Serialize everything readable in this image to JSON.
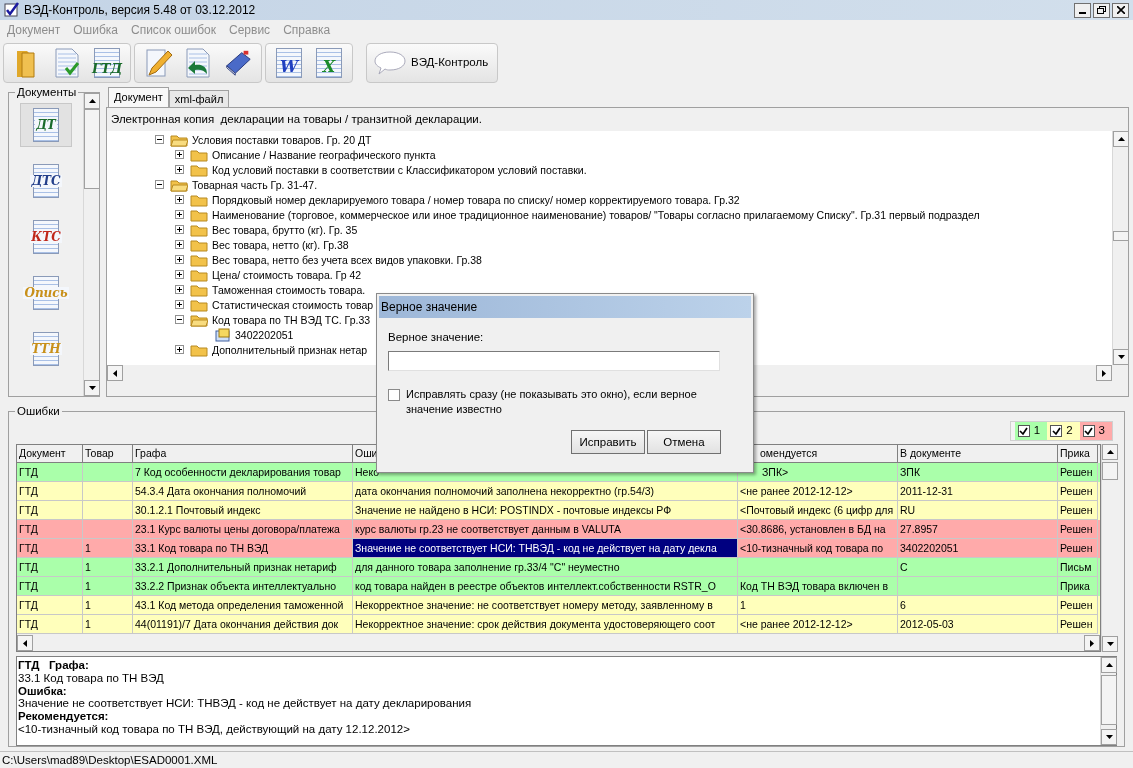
{
  "window": {
    "title": "ВЭД-Контроль, версия 5.48 от 03.12.2012"
  },
  "menu": [
    {
      "label": "Документ",
      "disabled": true
    },
    {
      "label": "Ошибка",
      "disabled": true
    },
    {
      "label": "Список ошибок",
      "disabled": true
    },
    {
      "label": "Сервис",
      "disabled": true
    },
    {
      "label": "Справка",
      "disabled": true
    }
  ],
  "toolbar": {
    "groups": [
      [
        {
          "kind": "folder"
        },
        {
          "kind": "check"
        },
        {
          "kind": "label",
          "label": "ГТД"
        }
      ],
      [
        {
          "kind": "pencil"
        },
        {
          "kind": "undo"
        },
        {
          "kind": "book"
        }
      ],
      [
        {
          "kind": "letter",
          "label": "W",
          "color": "#2040c0"
        },
        {
          "kind": "letter",
          "label": "X",
          "color": "#1a8a2a"
        }
      ]
    ],
    "app_button": {
      "label": "ВЭД-Контроль"
    }
  },
  "documents": {
    "title": "Документы",
    "items": [
      {
        "label": "ДТ",
        "color": "#1a6b2a",
        "selected": true
      },
      {
        "label": "ДТС",
        "color": "#233f8a",
        "selected": false
      },
      {
        "label": "КТС",
        "color": "#c0281c",
        "selected": false
      },
      {
        "label": "Опись",
        "color": "#c8901a",
        "selected": false
      },
      {
        "label": "ТТН",
        "color": "#c8901a",
        "selected": false
      }
    ]
  },
  "tabs": [
    {
      "label": "Документ",
      "selected": true
    },
    {
      "label": "xml-файл",
      "selected": false
    }
  ],
  "caption": "Электронная копия  декларации на товары / транзитной декларации.",
  "tree": [
    {
      "label": "Условия поставки товаров. Гр. 20 ДТ",
      "expanded": true,
      "children": [
        {
          "label": "Описание / Название географического пункта",
          "expanded": false
        },
        {
          "label": "Код условий поставки в соответствии с Классификатором условий поставки.",
          "expanded": false
        }
      ]
    },
    {
      "label": "Товарная часть Гр. 31-47.",
      "expanded": true,
      "children": [
        {
          "label": "Порядковый номер декларируемого  товара / номер товара по списку/ номер корректируемого товара.  Гр.32",
          "expanded": false
        },
        {
          "label": "Наименование (торговое, коммерческое или иное традиционное наименование) товаров/ \"Товары согласно прилагаемому Списку\". Гр.31 первый подраздел",
          "expanded": false
        },
        {
          "label": "Вес товара, брутто (кг). Гр. 35",
          "expanded": false
        },
        {
          "label": "Вес товара, нетто (кг). Гр.38",
          "expanded": false
        },
        {
          "label": "Вес товара, нетто без учета всех видов упаковки. Гр.38",
          "expanded": false
        },
        {
          "label": "Цена/ стоимость товара. Гр 42",
          "expanded": false
        },
        {
          "label": "Таможенная стоимость товара.",
          "expanded": false
        },
        {
          "label": "Статистическая стоимость товар",
          "expanded": false
        },
        {
          "label": "Код товара по ТН ВЭД ТС. Гр.33",
          "expanded": true,
          "children": [
            {
              "label": "3402202051",
              "kind": "value"
            }
          ]
        },
        {
          "label": "Дополнительный признак нетар",
          "expanded": false
        }
      ]
    }
  ],
  "errors": {
    "title": "Ошибки",
    "legend": [
      {
        "label": "1",
        "checked": true,
        "color": "#aaffaa"
      },
      {
        "label": "2",
        "checked": true,
        "color": "#ffffbb"
      },
      {
        "label": "3",
        "checked": true,
        "color": "#ffaaaa"
      }
    ],
    "columns": [
      "Документ",
      "Товар",
      "Графа",
      "Оши",
      "омендуется",
      "В документе",
      "Прика"
    ],
    "rows": [
      {
        "color": "#aaffaa",
        "selected": false,
        "cells": [
          "ГТД",
          "",
          "7 Код особенности декларирования товар",
          "Неко",
          "ЗПК>",
          "ЗПК",
          "Решен"
        ]
      },
      {
        "color": "#ffffbb",
        "selected": false,
        "cells": [
          "ГТД",
          "",
          "54.3.4 Дата окончания полномочий",
          "дата окончания полномочий заполнена некорректно (гр.54/3)",
          "<не ранее 2012-12-12>",
          "2011-12-31",
          "Решен"
        ]
      },
      {
        "color": "#ffffbb",
        "selected": false,
        "cells": [
          "ГТД",
          "",
          "30.1.2.1 Почтовый индекс",
          "Значение не найдено в НСИ: POSTINDX - почтовые индексы РФ",
          "<Почтовый индекс (6 цифр для",
          "RU",
          "Решен"
        ]
      },
      {
        "color": "#ffaaaa",
        "selected": false,
        "cells": [
          "ГТД",
          "",
          "23.1 Курс валюты цены договора/платежа",
          "курс валюты гр.23 не соответствует данным в VALUTA",
          "<30.8686, установлен в БД на",
          "27.8957",
          "Решен"
        ]
      },
      {
        "color": "#ffaaaa",
        "selected": true,
        "cells": [
          "ГТД",
          "1",
          "33.1 Код товара по ТН ВЭД",
          "Значение не соответствует НСИ: ТНВЭД - код не действует на дату декла",
          "<10-тизначный код товара по",
          "3402202051",
          "Решен"
        ]
      },
      {
        "color": "#aaffaa",
        "selected": false,
        "cells": [
          "ГТД",
          "1",
          "33.2.1 Дополнительный признак нетариф",
          "для данного товара заполнение гр.33/4 \"С\" неуместно",
          "",
          "С",
          "Письм"
        ]
      },
      {
        "color": "#aaffaa",
        "selected": false,
        "cells": [
          "ГТД",
          "1",
          "33.2.2 Признак объекта интеллектуально",
          "код товара найден в реестре объектов интеллект.собственности RSTR_O",
          "Код ТН ВЭД товара включен в",
          "",
          "Прика"
        ]
      },
      {
        "color": "#ffffbb",
        "selected": false,
        "cells": [
          "ГТД",
          "1",
          "43.1 Код метода определения таможенной",
          "Некорректное значение: не соответствует номеру методу, заявленному в",
          "1",
          "6",
          "Решен"
        ]
      },
      {
        "color": "#ffffbb",
        "selected": false,
        "cells": [
          "ГТД",
          "1",
          "44(01191)/7 Дата окончания действия док",
          "Некорректное значение: срок действия документа удостоверяющего соот",
          "<не ранее 2012-12-12>",
          "2012-05-03",
          "Решен"
        ]
      }
    ]
  },
  "details": [
    {
      "kind": "heading",
      "text": "ГТД   Графа:"
    },
    {
      "kind": "text",
      "text": "33.1 Код товара по ТН ВЭД"
    },
    {
      "kind": "heading",
      "text": "Ошибка:"
    },
    {
      "kind": "text",
      "text": "Значение не соответствует НСИ: ТНВЭД - код не действует на дату декларирования"
    },
    {
      "kind": "heading",
      "text": "Рекомендуется:"
    },
    {
      "kind": "text",
      "text": "<10-тизначный код товара по ТН ВЭД, действующий на дату 12.12.2012>"
    }
  ],
  "dialog": {
    "title": "Верное значение",
    "field_label": "Верное значение:",
    "checkbox": {
      "label": "Исправлять сразу (не показывать это окно), если верное значение известно",
      "checked": false
    },
    "buttons": [
      "Исправить",
      "Отмена"
    ]
  },
  "status_bar": "C:\\Users\\mad89\\Desktop\\ESAD0001.XML"
}
